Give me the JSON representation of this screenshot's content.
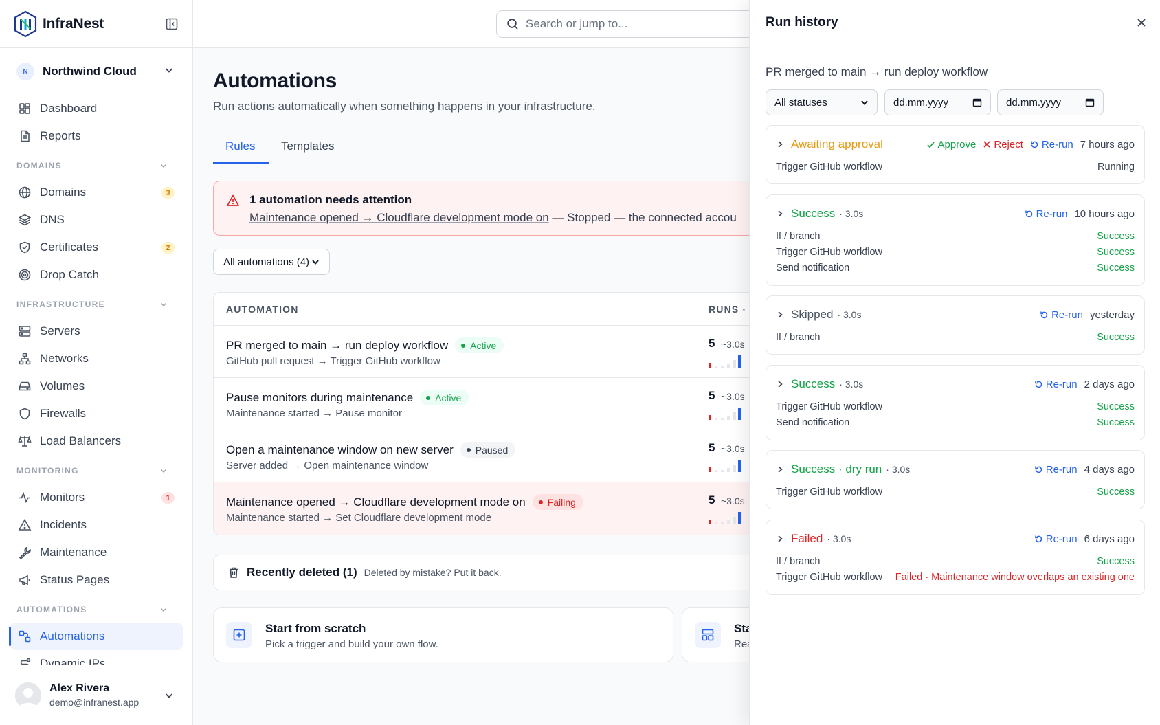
{
  "brand": {
    "name": "InfraNest"
  },
  "org": {
    "initial": "N",
    "name": "Northwind Cloud"
  },
  "nav": {
    "top": [
      {
        "label": "Dashboard",
        "icon": "dashboard-icon"
      },
      {
        "label": "Reports",
        "icon": "document-icon"
      }
    ],
    "sections": [
      {
        "title": "DOMAINS",
        "items": [
          {
            "label": "Domains",
            "icon": "globe-icon",
            "badge": "3"
          },
          {
            "label": "DNS",
            "icon": "layers-icon"
          },
          {
            "label": "Certificates",
            "icon": "shield-check-icon",
            "badge": "2"
          },
          {
            "label": "Drop Catch",
            "icon": "target-icon"
          }
        ]
      },
      {
        "title": "INFRASTRUCTURE",
        "items": [
          {
            "label": "Servers",
            "icon": "server-icon"
          },
          {
            "label": "Networks",
            "icon": "network-icon"
          },
          {
            "label": "Volumes",
            "icon": "drive-icon"
          },
          {
            "label": "Firewalls",
            "icon": "shield-icon"
          },
          {
            "label": "Load Balancers",
            "icon": "scale-icon"
          }
        ]
      },
      {
        "title": "MONITORING",
        "items": [
          {
            "label": "Monitors",
            "icon": "activity-icon",
            "badge": "1"
          },
          {
            "label": "Incidents",
            "icon": "warning-icon"
          },
          {
            "label": "Maintenance",
            "icon": "wrench-icon"
          },
          {
            "label": "Status Pages",
            "icon": "megaphone-icon"
          }
        ]
      },
      {
        "title": "AUTOMATIONS",
        "items": [
          {
            "label": "Automations",
            "icon": "workflow-icon"
          },
          {
            "label": "Dynamic IPs",
            "icon": "route-icon"
          }
        ]
      }
    ]
  },
  "user": {
    "name": "Alex Rivera",
    "email": "demo@infranest.app"
  },
  "search": {
    "placeholder": "Search or jump to..."
  },
  "page": {
    "title": "Automations",
    "subtitle": "Run actions automatically when something happens in your infrastructure.",
    "tabs": [
      "Rules",
      "Templates"
    ]
  },
  "alert": {
    "title": "1 automation needs attention",
    "link": "Maintenance opened → Cloudflare development mode on",
    "rest": " — Stopped — the connected accou"
  },
  "filter": {
    "selected": "All automations (4)"
  },
  "table": {
    "col_automation": "AUTOMATION",
    "col_runs": "RUNS · ",
    "rows": [
      {
        "title": "PR merged to main → run deploy workflow",
        "status": "Active",
        "sub": "GitHub pull request → Trigger GitHub workflow",
        "runs": "5",
        "dur": "~3.0s"
      },
      {
        "title": "Pause monitors during maintenance",
        "status": "Active",
        "sub": "Maintenance started → Pause monitor",
        "runs": "5",
        "dur": "~3.0s"
      },
      {
        "title": "Open a maintenance window on new server",
        "status": "Paused",
        "sub": "Server added → Open maintenance window",
        "runs": "5",
        "dur": "~3.0s"
      },
      {
        "title": "Maintenance opened → Cloudflare development mode on",
        "status": "Failing",
        "sub": "Maintenance started → Set Cloudflare development mode",
        "runs": "5",
        "dur": "~3.0s"
      }
    ]
  },
  "deleted": {
    "title": "Recently deleted (1)",
    "desc": "Deleted by mistake? Put it back."
  },
  "cards": [
    {
      "title": "Start from scratch",
      "desc": "Pick a trigger and build your own flow."
    },
    {
      "title": "Sta",
      "desc": "Rea"
    }
  ],
  "colors": {
    "accent": "#2563eb",
    "success": "#16a34a",
    "danger": "#dc2626",
    "warning": "#e69a14"
  },
  "drawer": {
    "title": "Run history",
    "subtitle": "PR merged to main → run deploy workflow",
    "status_filter": "All statuses",
    "date_from": "dd.mm.yyyy",
    "date_to": "dd.mm.yyyy",
    "actions": {
      "approve": "Approve",
      "reject": "Reject",
      "rerun": "Re-run"
    },
    "runs": [
      {
        "status": "Awaiting approval",
        "tone": "amber",
        "dur": "",
        "ago": "7 hours ago",
        "approval": true,
        "steps": [
          {
            "name": "Trigger GitHub workflow",
            "result": "Running",
            "tone": "plain"
          }
        ]
      },
      {
        "status": "Success",
        "tone": "green",
        "dur": "· 3.0s",
        "ago": "10 hours ago",
        "steps": [
          {
            "name": "If / branch",
            "result": "Success",
            "tone": "ok"
          },
          {
            "name": "Trigger GitHub workflow",
            "result": "Success",
            "tone": "ok"
          },
          {
            "name": "Send notification",
            "result": "Success",
            "tone": "ok"
          }
        ]
      },
      {
        "status": "Skipped",
        "tone": "gray",
        "dur": "· 3.0s",
        "ago": "yesterday",
        "steps": [
          {
            "name": "If / branch",
            "result": "Success",
            "tone": "ok"
          }
        ]
      },
      {
        "status": "Success",
        "tone": "green",
        "dur": "· 3.0s",
        "ago": "2 days ago",
        "steps": [
          {
            "name": "Trigger GitHub workflow",
            "result": "Success",
            "tone": "ok"
          },
          {
            "name": "Send notification",
            "result": "Success",
            "tone": "ok"
          }
        ]
      },
      {
        "status": "Success · dry run",
        "tone": "green",
        "dur": "· 3.0s",
        "ago": "4 days ago",
        "steps": [
          {
            "name": "Trigger GitHub workflow",
            "result": "Success",
            "tone": "ok"
          }
        ]
      },
      {
        "status": "Failed",
        "tone": "red",
        "dur": "· 3.0s",
        "ago": "6 days ago",
        "steps": [
          {
            "name": "If / branch",
            "result": "Success",
            "tone": "ok"
          },
          {
            "name": "Trigger GitHub workflow",
            "result": "Failed · Maintenance window overlaps an existing one",
            "tone": "bad"
          }
        ]
      }
    ]
  }
}
